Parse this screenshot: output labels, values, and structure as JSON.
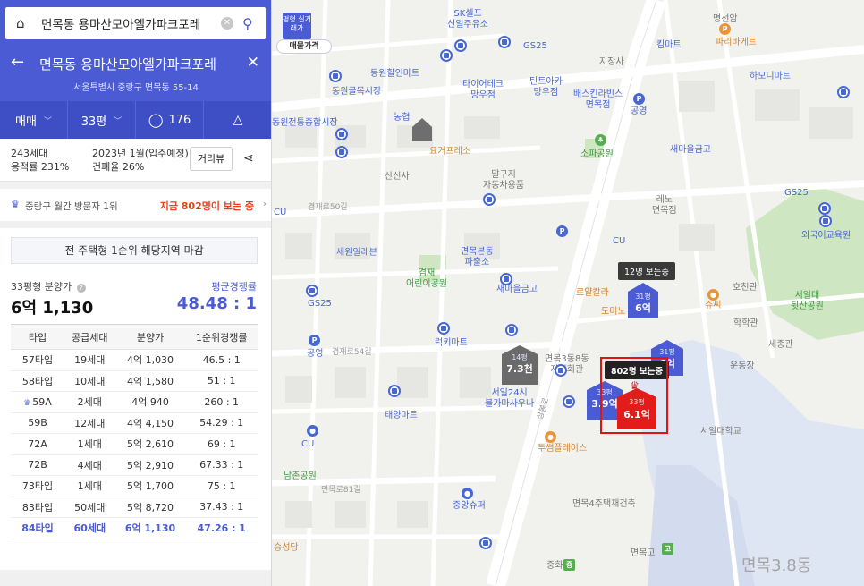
{
  "search": {
    "query": "면목동 용마산모아엘가파크포레",
    "search_icon": "magnifier-icon",
    "home_icon": "home-icon"
  },
  "header": {
    "title": "면목동 용마산모아엘가파크포레",
    "address": "서울특별시 중랑구 면목동 55-14"
  },
  "tabs": {
    "deal": "매매",
    "area": "33평",
    "comments": "176"
  },
  "summary": {
    "households": "243세대",
    "floor_area_ratio": "용적률 231%",
    "move_in": "2023년 1월(입주예정)",
    "coverage_ratio": "건폐율 26%",
    "street_view": "거리뷰"
  },
  "ranking": {
    "label": "중랑구 월간 방문자 1위",
    "now_viewing": "지금 802명이 보는 중"
  },
  "notice": "전 주택형 1순위 해당지역 마감",
  "price": {
    "label": "33평형 분양가",
    "value": "6억 1,130",
    "competition_label": "평균경쟁률",
    "competition_value": "48.48 : 1"
  },
  "table": {
    "headers": [
      "타입",
      "공급세대",
      "분양가",
      "1순위경쟁률"
    ],
    "rows": [
      [
        "57타입",
        "19세대",
        "4억 1,030",
        "46.5 : 1"
      ],
      [
        "58타입",
        "10세대",
        "4억 1,580",
        "51 : 1"
      ],
      [
        "59A",
        "2세대",
        "4억 940",
        "260 : 1"
      ],
      [
        "59B",
        "12세대",
        "4억 4,150",
        "54.29 : 1"
      ],
      [
        "72A",
        "1세대",
        "5억 2,610",
        "69 : 1"
      ],
      [
        "72B",
        "4세대",
        "5억 2,910",
        "67.33 : 1"
      ],
      [
        "73타입",
        "1세대",
        "5억 1,700",
        "75 : 1"
      ],
      [
        "83타입",
        "50세대",
        "5억 8,720",
        "37.43 : 1"
      ],
      [
        "84타입",
        "60세대",
        "6억 1,130",
        "47.26 : 1"
      ]
    ],
    "crown_row": 2,
    "highlight_row": 8
  },
  "map": {
    "filter": {
      "flag": "평형 실거래가",
      "pill": "매물가격"
    },
    "zone_label": "면목3.8동",
    "tooltip_12": "12명 보는중",
    "tooltip_802": "802명 보는중",
    "markers": {
      "m1": {
        "top": "31평",
        "val": "6억"
      },
      "m2": {
        "top": "31평",
        "val": "6억"
      },
      "m3": {
        "top": "14평",
        "val": "7.3천"
      },
      "m4": {
        "top": "33평",
        "val": "3.9억"
      },
      "m5": {
        "top": "33평",
        "val": "6.1억"
      }
    },
    "pois": {
      "sk": "SK셀프\n신일주유소",
      "myeongseon": "명선암",
      "paris": "파리바게트",
      "gs25a": "GS25",
      "kimart": "킴마트",
      "jisang": "지장사",
      "dongwon": "동원할인마트",
      "dongwon_mkt": "동원골목시장",
      "tire": "타이어테크\n망우점",
      "tintoa": "틴트아카\n망우점",
      "baskin": "배스킨라빈스\n면목점",
      "hamoni": "하모니마트",
      "nonghyup": "농협",
      "dongwonjt": "동원전통종합시장",
      "yogurt": "요거프레소",
      "somapark": "소파공원",
      "saemaeul": "새마을금고",
      "saemaeul2": "새마을금고",
      "sansinsa": "산신사",
      "dalguji": "달구지\n자동차용품",
      "reno": "레노\n면목점",
      "gs25b": "GS25",
      "sewon": "세원일레븐",
      "police": "면목본동\n파출소",
      "gyeomjae": "겸재\n어린이공원",
      "samaeul3": "새마을금고",
      "gs25c": "GS25",
      "royal": "로얄칼라",
      "domino": "도미노",
      "jussi": "쥬씨",
      "hochun": "호천관",
      "seoilpark": "서일대\n뒷산공원",
      "hakhak": "학학관",
      "sejong": "세종관",
      "undong": "운동장",
      "seoilu": "서일대학교",
      "gongyeong": "공영",
      "leekmart": "럭키마트",
      "myeonmok38": "면목3동8동\n자치회관",
      "seoil24": "서일24시\n불가마사우나",
      "taeyang": "태양마트",
      "toosome": "투썸플레이스",
      "namchon": "남촌공원",
      "jungang": "중앙슈퍼",
      "myeonmok4": "면목4주택재건축",
      "myeonmokgo": "면목고",
      "junghwa": "중화",
      "oegook": "외국어교육원",
      "cu1": "CU",
      "cu2": "CU",
      "cu3": "CU",
      "gongyeong2": "공영",
      "sungsang": "승성당"
    },
    "roads": {
      "r1": "겸재로50길",
      "r2": "겸재로54길",
      "r3": "면목로81길",
      "r4": "상봉로"
    }
  },
  "colors": {
    "accent": "#4a5bd4",
    "now_viewing": "#e8401d",
    "highlight_marker": "#e21b1b"
  }
}
